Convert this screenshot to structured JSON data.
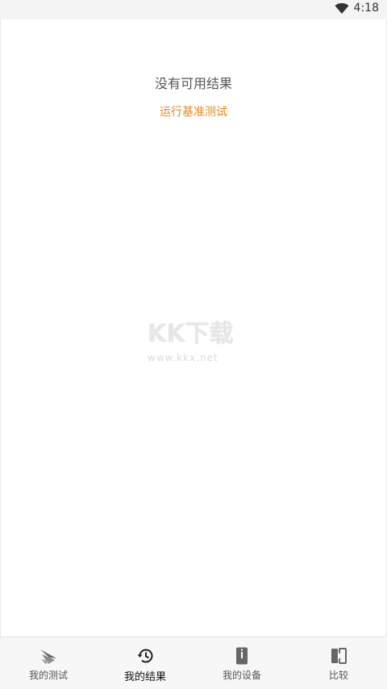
{
  "status_bar": {
    "time": "4:18",
    "icons": [
      "wifi-icon"
    ]
  },
  "main": {
    "empty_title": "没有可用结果",
    "run_link": "运行基准测试"
  },
  "watermark": {
    "logo": "KK下载",
    "url": "www.kkx.net"
  },
  "bottom_nav": {
    "active_index": 1,
    "items": [
      {
        "label": "我的测试",
        "icon": "benchmark-logo-icon"
      },
      {
        "label": "我的结果",
        "icon": "history-icon"
      },
      {
        "label": "我的设备",
        "icon": "device-info-icon"
      },
      {
        "label": "比较",
        "icon": "compare-icon"
      }
    ]
  },
  "colors": {
    "accent": "#e8861a",
    "text_muted": "#555555",
    "nav_background": "#f7f7f7"
  }
}
